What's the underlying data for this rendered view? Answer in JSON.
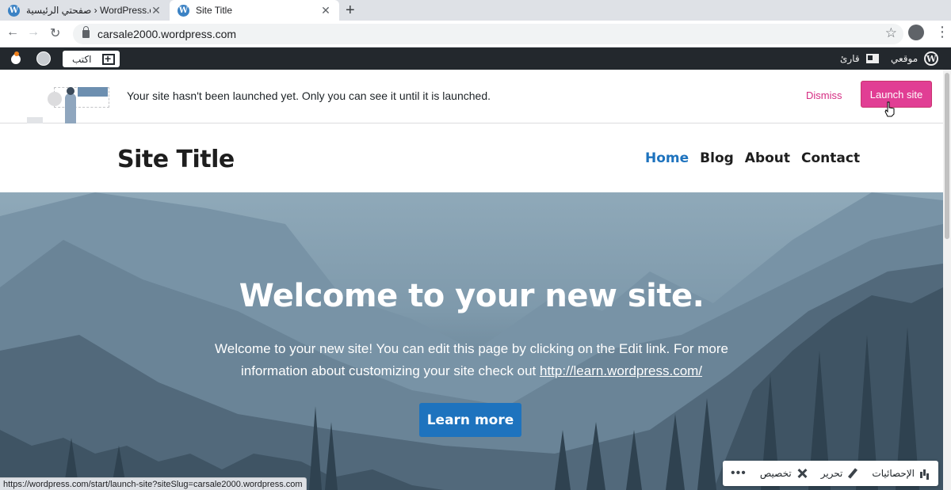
{
  "browser": {
    "tabs": [
      {
        "title": "صفحتي الرئيسية › WordPress.com"
      },
      {
        "title": "Site Title"
      }
    ],
    "url": "carsale2000.wordpress.com",
    "status_url": "https://wordpress.com/start/launch-site?siteSlug=carsale2000.wordpress.com"
  },
  "admin_bar": {
    "write_label": "اكتب",
    "reader_label": "قارئ",
    "my_site_label": "موقعي"
  },
  "banner": {
    "message": "Your site hasn't been launched yet. Only you can see it until it is launched.",
    "dismiss_label": "Dismiss",
    "launch_label": "Launch site"
  },
  "site": {
    "title": "Site Title",
    "nav": [
      "Home",
      "Blog",
      "About",
      "Contact"
    ],
    "active_nav": "Home"
  },
  "hero": {
    "title": "Welcome to your new site.",
    "text_before_link": "Welcome to your new site! You can edit this page by clicking on the Edit link. For more information about customizing your site check out ",
    "link_text": "http://learn.wordpress.com/",
    "button_label": "Learn more"
  },
  "action_bar": {
    "stats_label": "الإحصائيات",
    "edit_label": "تحرير",
    "customize_label": "تخصيص",
    "more_label": "•••"
  },
  "colors": {
    "accent_pink": "#e13e94",
    "link_blue": "#1e73be",
    "admin_bar": "#23282d"
  }
}
